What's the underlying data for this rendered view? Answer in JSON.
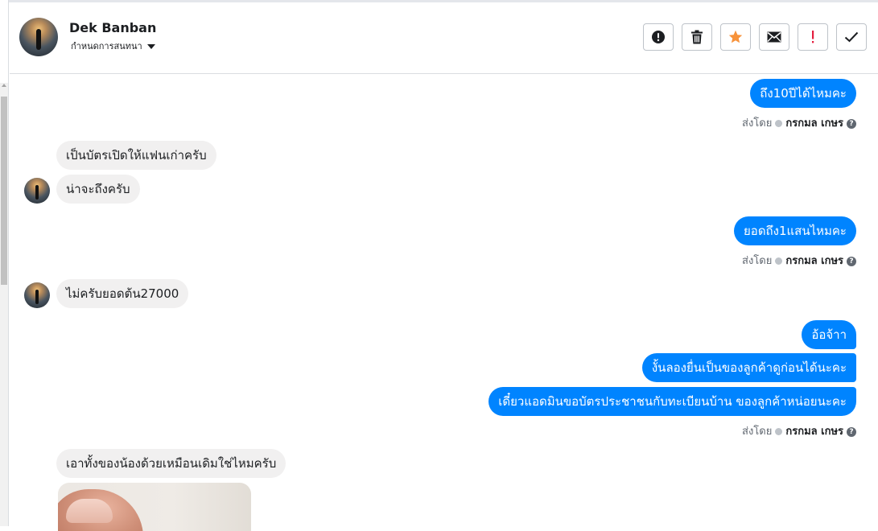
{
  "header": {
    "contact_name": "Dek Banban",
    "subtitle": "กำหนดการสนทนา",
    "actions": [
      {
        "name": "report-icon",
        "glyph": "!"
      },
      {
        "name": "trash-icon"
      },
      {
        "name": "star-icon",
        "color": "#f7923a"
      },
      {
        "name": "mail-icon"
      },
      {
        "name": "spam-icon",
        "glyph": "!",
        "color": "#e41e3f"
      },
      {
        "name": "check-icon"
      }
    ]
  },
  "messages": {
    "m1": "ถึง10ปีได้ไหมคะ",
    "m2": "เป็นบัตรเปิดให้แฟนเก่าครับ",
    "m3": "น่าจะถึงครับ",
    "m4": "ยอดถึง1แสนไหมคะ",
    "m5": "ไม่ครับยอดต้น27000",
    "m6": "อ้อจ้าา",
    "m7": "งั้นลองยื่นเป็นของลูกค้าดูก่อนได้นะคะ",
    "m8": "เดี๋ยวแอดมินขอบัตรประชาชนกับทะเบียนบ้าน ของลูกค้าหน่อยนะคะ",
    "m9": "เอาทั้งของน้องด้วยเหมือนเดิมใช่ไหมครับ"
  },
  "sent_by": {
    "label": "ส่งโดย",
    "agent": "กรกมล เกษร",
    "help": "?"
  },
  "colors": {
    "outgoing": "#0084ff",
    "incoming": "#f1f0f0",
    "star": "#f7923a",
    "spam": "#e41e3f"
  }
}
